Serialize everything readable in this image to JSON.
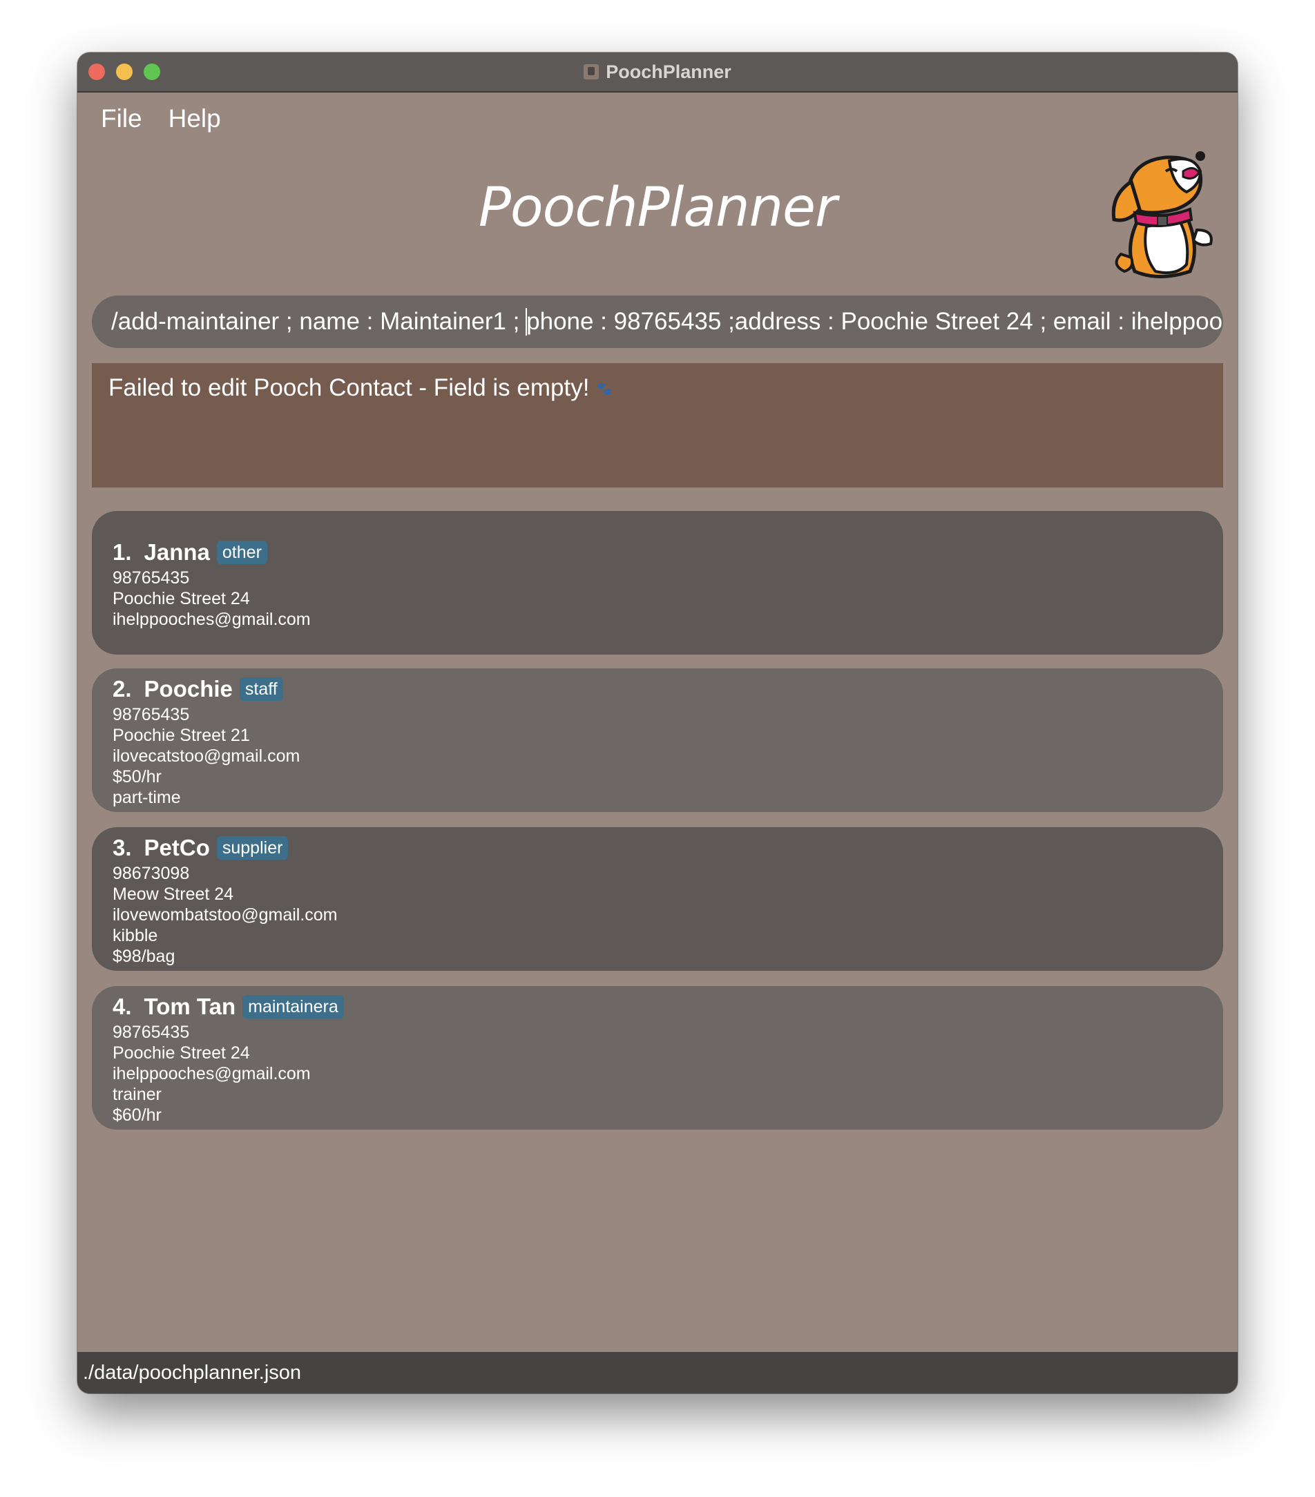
{
  "window": {
    "title": "PoochPlanner"
  },
  "menu": {
    "file": "File",
    "help": "Help"
  },
  "header": {
    "title": "PoochPlanner"
  },
  "command": {
    "value": "/add-maintainer ; name : Maintainer1 ; phone : 98765435 ;address : Poochie Street 24 ; email : ihelppoo"
  },
  "result": {
    "message": "Failed to edit Pooch Contact - Field is empty!"
  },
  "contacts": [
    {
      "index": "1.",
      "name": "Janna",
      "tag": "other",
      "lines": [
        "98765435",
        "Poochie Street 24",
        "ihelppooches@gmail.com"
      ]
    },
    {
      "index": "2.",
      "name": "Poochie",
      "tag": "staff",
      "lines": [
        "98765435",
        "Poochie Street 21",
        "ilovecatstoo@gmail.com",
        "$50/hr",
        "part-time"
      ]
    },
    {
      "index": "3.",
      "name": "PetCo",
      "tag": "supplier",
      "lines": [
        "98673098",
        "Meow Street 24",
        "ilovewombatstoo@gmail.com",
        "kibble",
        "$98/bag"
      ]
    },
    {
      "index": "4.",
      "name": "Tom Tan",
      "tag": "maintainera",
      "lines": [
        "98765435",
        "Poochie Street 24",
        "ihelppooches@gmail.com",
        "trainer",
        "$60/hr"
      ]
    }
  ],
  "status": {
    "path": "./data/poochplanner.json"
  },
  "colors": {
    "background": "#988880",
    "result_bg": "#765b4f",
    "tag_bg": "#3d6e8a",
    "card_dark": "#5e5956",
    "card_light": "#6d6866"
  },
  "icons": {
    "mascot": "dog-mascot-icon",
    "paw": "paw-icon",
    "app": "app-icon"
  }
}
